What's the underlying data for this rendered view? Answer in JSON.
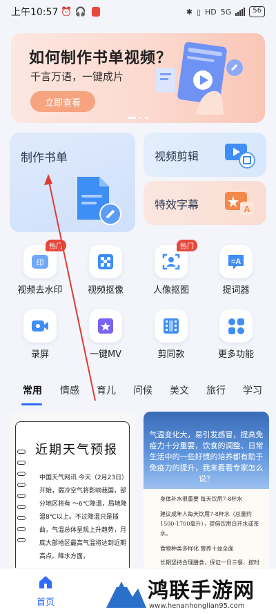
{
  "status_bar": {
    "time": "上午10:57",
    "network": "5G",
    "hd": "HD",
    "battery": "56"
  },
  "banner": {
    "title": "如何制作书单视频？",
    "subtitle": "千言万语，一键成片",
    "button": "立即查看"
  },
  "feature_cards": {
    "make_booklist": "制作书单",
    "video_edit": "视频剪辑",
    "special_subtitle": "特效字幕"
  },
  "tools": [
    {
      "label": "视频去水印",
      "badge": "热门",
      "icon": "watermark-icon"
    },
    {
      "label": "视频抠像",
      "badge": "",
      "icon": "matting-icon"
    },
    {
      "label": "人像抠图",
      "badge": "热门",
      "icon": "portrait-icon"
    },
    {
      "label": "提词器",
      "badge": "",
      "icon": "teleprompter-icon"
    },
    {
      "label": "录屏",
      "badge": "",
      "icon": "record-icon"
    },
    {
      "label": "一键MV",
      "badge": "",
      "icon": "mv-icon"
    },
    {
      "label": "剪同款",
      "badge": "",
      "icon": "template-icon"
    },
    {
      "label": "更多功能",
      "badge": "",
      "icon": "more-icon"
    }
  ],
  "tabs": [
    "常用",
    "情感",
    "育儿",
    "问候",
    "美文",
    "旅行",
    "学习"
  ],
  "content": {
    "left": {
      "title": "近期天气预报",
      "body": "中国天气网讯 今天（2月23日）开始，弱冷空气将影响我国，部分地区将有 ～6℃降温，局地降温8℃以上。不过降温只是插曲，气温总体呈现上升趋势，月底大部地区最高气温将达到近期高点。降水方面，"
    },
    "right": {
      "head": "气温变化大，易引发感冒，提高免疫力十分重要，饮食的调整、日常生活中的一些好惯的培养都有助于免疫力的提升，我来看看专家怎么说？",
      "line1": "身体补水很重要 每天饮用7-8杯水",
      "line2": "建议成年人每天饮用7-8杯水（总量约1500-1700毫升），提倡饮用白开水或茶水。",
      "line3": "食物种类多样化 营养十益全面",
      "line4": "长期坚持合理膳食，保证一日三餐、按时吃饭，是机体生理功能和免疫功能的重要保障"
    }
  },
  "bottom_nav": {
    "home": "首页"
  },
  "watermark": {
    "text": "鸿联手游网",
    "url": "www.henanhonglian95.com"
  },
  "colors": {
    "accent": "#2f6bff",
    "hot_badge": "#e8473c",
    "annotation_arrow": "#e03a2f"
  }
}
